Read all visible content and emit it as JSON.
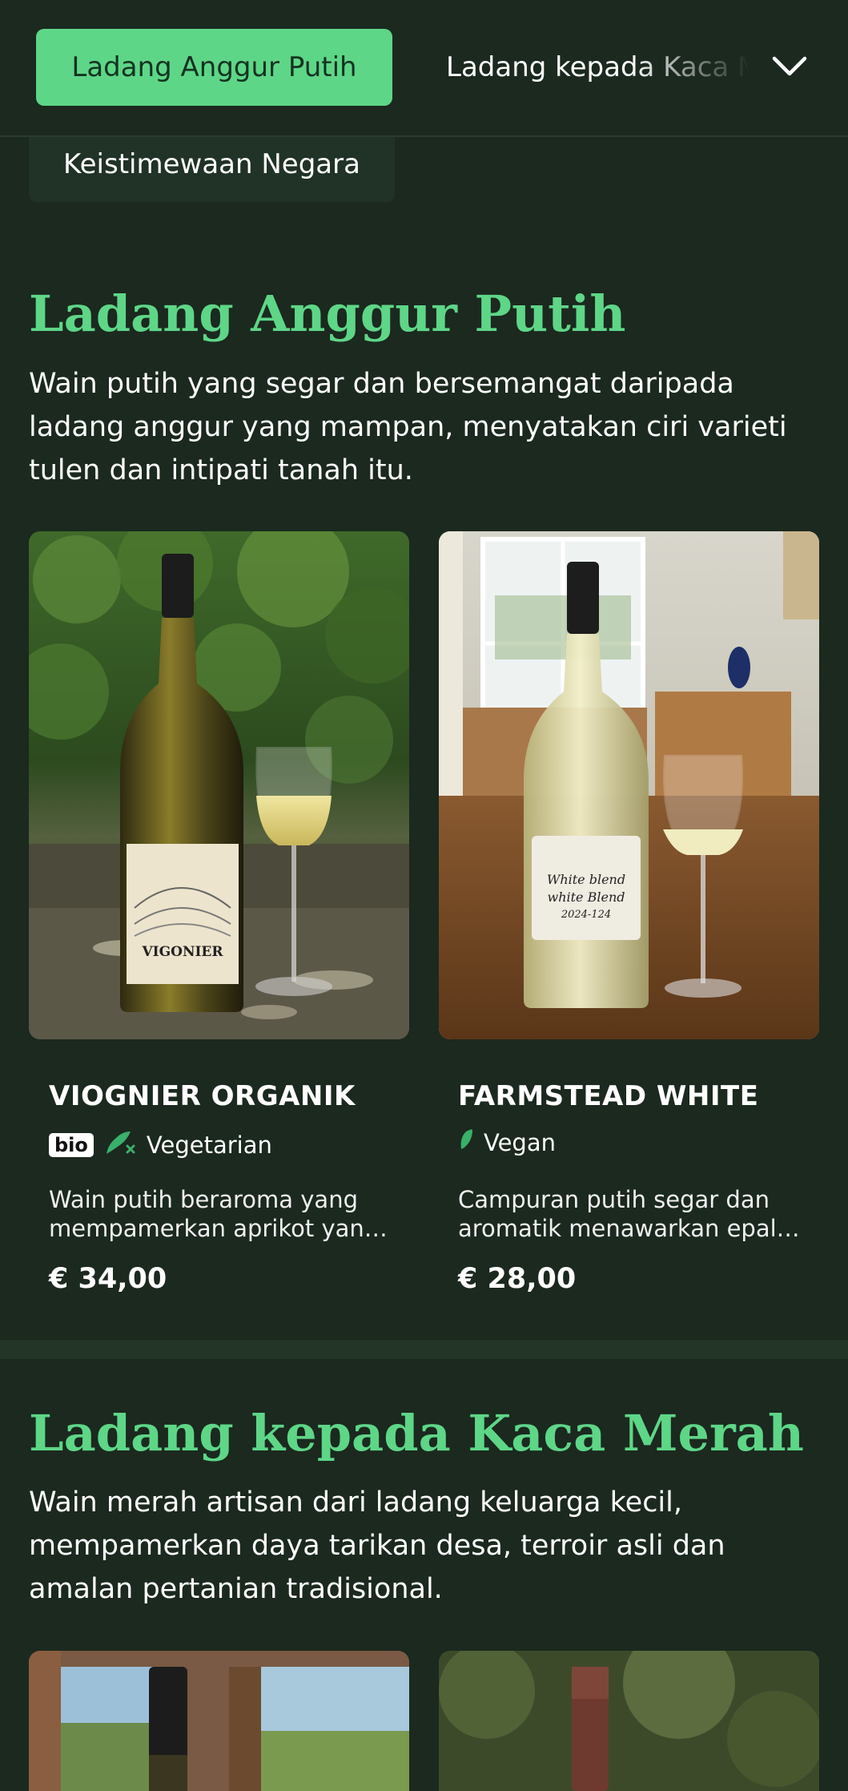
{
  "nav": {
    "active_tab": "Ladang Anggur Putih",
    "next_tab": "Ladang kepada Kaca Merah",
    "second_row_tab": "Keistimewaan Negara"
  },
  "sections": [
    {
      "title": "Ladang Anggur Putih",
      "description": "Wain putih yang segar dan bersemangat daripada ladang anggur yang mampan, menyatakan ciri varieti tulen dan intipati tanah itu.",
      "products": [
        {
          "name": "VIOGNIER ORGANIK",
          "badge": "bio",
          "diet_label": "Vegetarian",
          "diet_icon": "vegetarian-icon",
          "description": "Wain putih beraroma yang mempamerkan aprikot yang matang dan nota bunga.",
          "price": "€ 34,00",
          "label_text": "VIGONIER"
        },
        {
          "name": "FARMSTEAD WHITE",
          "diet_label": "Vegan",
          "diet_icon": "vegan-leaf-icon",
          "description": "Campuran putih segar dan aromatik menawarkan epal hijau dan sitrus.",
          "price": "€ 28,00",
          "label_text": "White blend & white Blend 2024-124"
        }
      ]
    },
    {
      "title": "Ladang kepada Kaca Merah",
      "description": "Wain merah artisan dari ladang keluarga kecil, mempamerkan daya tarikan desa, terroir asli dan amalan pertanian tradisional."
    }
  ],
  "colors": {
    "background": "#1b291f",
    "accent": "#5ed687",
    "card_bg": "#213226"
  }
}
